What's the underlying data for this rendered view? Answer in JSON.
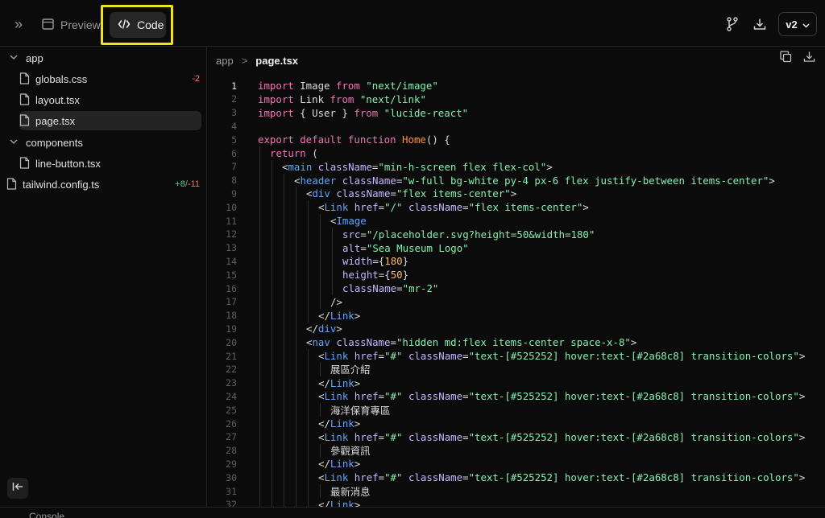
{
  "toolbar": {
    "preview_label": "Preview",
    "code_label": "Code",
    "version_label": "v2"
  },
  "sidebar": {
    "items": [
      {
        "label": "app",
        "type": "folder"
      },
      {
        "label": "globals.css",
        "type": "file",
        "del": "-2"
      },
      {
        "label": "layout.tsx",
        "type": "file"
      },
      {
        "label": "page.tsx",
        "type": "file",
        "selected": true
      },
      {
        "label": "components",
        "type": "folder"
      },
      {
        "label": "line-button.tsx",
        "type": "file"
      },
      {
        "label": "tailwind.config.ts",
        "type": "file",
        "add": "+8",
        "slash": "/",
        "del": "-11"
      }
    ]
  },
  "breadcrumb": {
    "folder": "app",
    "separator": ">",
    "file": "page.tsx"
  },
  "bottom": {
    "label": "Console"
  },
  "colors": {
    "keyword": "#f472b6",
    "string": "#86efac",
    "tag": "#60a5fa",
    "attribute": "#c4b5fd",
    "function": "#fb923c",
    "highlight": "#f2e21a"
  },
  "code_lines": [
    {
      "n": "1",
      "indent": 0,
      "parts": [
        [
          "kw",
          "import"
        ],
        [
          "",
          "Image "
        ],
        [
          "kw",
          "from"
        ],
        [
          "",
          ""
        ],
        [
          "str",
          "\"next/image\""
        ]
      ]
    },
    {
      "n": "2",
      "indent": 0,
      "parts": [
        [
          "kw",
          "import"
        ],
        [
          "",
          "Link "
        ],
        [
          "kw",
          "from"
        ],
        [
          "",
          ""
        ],
        [
          "str",
          "\"next/link\""
        ]
      ]
    },
    {
      "n": "3",
      "indent": 0,
      "parts": [
        [
          "kw",
          "import"
        ],
        [
          "",
          "{ User } "
        ],
        [
          "kw",
          "from"
        ],
        [
          "",
          ""
        ],
        [
          "str",
          "\"lucide-react\""
        ]
      ]
    },
    {
      "n": "4",
      "indent": 0,
      "parts": []
    },
    {
      "n": "5",
      "indent": 0,
      "parts": [
        [
          "kw",
          "export default function "
        ],
        [
          "fn",
          "Home"
        ],
        [
          "",
          "() {"
        ]
      ]
    },
    {
      "n": "6",
      "indent": 1,
      "parts": [
        [
          "kw",
          "return"
        ],
        [
          "",
          "("
        ]
      ]
    },
    {
      "n": "7",
      "indent": 2,
      "parts": [
        [
          "",
          "<"
        ],
        [
          "tag",
          "main"
        ],
        [
          "attr",
          " className"
        ],
        [
          "",
          "="
        ],
        [
          "str",
          "\"min-h-screen flex flex-col\""
        ],
        [
          "",
          ">"
        ]
      ]
    },
    {
      "n": "8",
      "indent": 3,
      "parts": [
        [
          "",
          "<"
        ],
        [
          "tag",
          "header"
        ],
        [
          "attr",
          " className"
        ],
        [
          "",
          "="
        ],
        [
          "str",
          "\"w-full bg-white py-4 px-6 flex justify-between items-center\""
        ],
        [
          "",
          ">"
        ]
      ]
    },
    {
      "n": "9",
      "indent": 4,
      "parts": [
        [
          "",
          "<"
        ],
        [
          "tag",
          "div"
        ],
        [
          "attr",
          " className"
        ],
        [
          "",
          "="
        ],
        [
          "str",
          "\"flex items-center\""
        ],
        [
          "",
          ">"
        ]
      ]
    },
    {
      "n": "10",
      "indent": 5,
      "parts": [
        [
          "",
          "<"
        ],
        [
          "tag",
          "Link"
        ],
        [
          "attr",
          " href"
        ],
        [
          "",
          "="
        ],
        [
          "str",
          "\"/\""
        ],
        [
          "attr",
          " className"
        ],
        [
          "",
          "="
        ],
        [
          "str",
          "\"flex items-center\""
        ],
        [
          "",
          ">"
        ]
      ]
    },
    {
      "n": "11",
      "indent": 6,
      "parts": [
        [
          "",
          "<"
        ],
        [
          "tag",
          "Image"
        ]
      ]
    },
    {
      "n": "12",
      "indent": 7,
      "parts": [
        [
          "attr",
          "src"
        ],
        [
          "",
          "="
        ],
        [
          "str",
          "\"/placeholder.svg?height=50&width=180\""
        ]
      ]
    },
    {
      "n": "13",
      "indent": 7,
      "parts": [
        [
          "attr",
          "alt"
        ],
        [
          "",
          "="
        ],
        [
          "str",
          "\"Sea Museum Logo\""
        ]
      ]
    },
    {
      "n": "14",
      "indent": 7,
      "parts": [
        [
          "attr",
          "width"
        ],
        [
          "",
          "={"
        ],
        [
          "num",
          "180"
        ],
        [
          "",
          "}"
        ]
      ]
    },
    {
      "n": "15",
      "indent": 7,
      "parts": [
        [
          "attr",
          "height"
        ],
        [
          "",
          "={"
        ],
        [
          "num",
          "50"
        ],
        [
          "",
          "}"
        ]
      ]
    },
    {
      "n": "16",
      "indent": 7,
      "parts": [
        [
          "attr",
          "className"
        ],
        [
          "",
          "="
        ],
        [
          "str",
          "\"mr-2\""
        ]
      ]
    },
    {
      "n": "17",
      "indent": 6,
      "parts": [
        [
          "",
          "/>"
        ]
      ]
    },
    {
      "n": "18",
      "indent": 5,
      "parts": [
        [
          "",
          "</"
        ],
        [
          "tag",
          "Link"
        ],
        [
          "",
          ">"
        ]
      ]
    },
    {
      "n": "19",
      "indent": 4,
      "parts": [
        [
          "",
          "</"
        ],
        [
          "tag",
          "div"
        ],
        [
          "",
          ">"
        ]
      ]
    },
    {
      "n": "20",
      "indent": 4,
      "parts": [
        [
          "",
          "<"
        ],
        [
          "tag",
          "nav"
        ],
        [
          "attr",
          " className"
        ],
        [
          "",
          "="
        ],
        [
          "str",
          "\"hidden md:flex items-center space-x-8\""
        ],
        [
          "",
          ">"
        ]
      ]
    },
    {
      "n": "21",
      "indent": 5,
      "parts": [
        [
          "",
          "<"
        ],
        [
          "tag",
          "Link"
        ],
        [
          "attr",
          " href"
        ],
        [
          "",
          "="
        ],
        [
          "str",
          "\"#\""
        ],
        [
          "attr",
          " className"
        ],
        [
          "",
          "="
        ],
        [
          "str",
          "\"text-[#525252] hover:text-[#2a68c8] transition-colors\""
        ],
        [
          "",
          ">"
        ]
      ]
    },
    {
      "n": "22",
      "indent": 6,
      "parts": [
        [
          "",
          "展區介紹"
        ]
      ]
    },
    {
      "n": "23",
      "indent": 5,
      "parts": [
        [
          "",
          "</"
        ],
        [
          "tag",
          "Link"
        ],
        [
          "",
          ">"
        ]
      ]
    },
    {
      "n": "24",
      "indent": 5,
      "parts": [
        [
          "",
          "<"
        ],
        [
          "tag",
          "Link"
        ],
        [
          "attr",
          " href"
        ],
        [
          "",
          "="
        ],
        [
          "str",
          "\"#\""
        ],
        [
          "attr",
          " className"
        ],
        [
          "",
          "="
        ],
        [
          "str",
          "\"text-[#525252] hover:text-[#2a68c8] transition-colors\""
        ],
        [
          "",
          ">"
        ]
      ]
    },
    {
      "n": "25",
      "indent": 6,
      "parts": [
        [
          "",
          "海洋保育專區"
        ]
      ]
    },
    {
      "n": "26",
      "indent": 5,
      "parts": [
        [
          "",
          "</"
        ],
        [
          "tag",
          "Link"
        ],
        [
          "",
          ">"
        ]
      ]
    },
    {
      "n": "27",
      "indent": 5,
      "parts": [
        [
          "",
          "<"
        ],
        [
          "tag",
          "Link"
        ],
        [
          "attr",
          " href"
        ],
        [
          "",
          "="
        ],
        [
          "str",
          "\"#\""
        ],
        [
          "attr",
          " className"
        ],
        [
          "",
          "="
        ],
        [
          "str",
          "\"text-[#525252] hover:text-[#2a68c8] transition-colors\""
        ],
        [
          "",
          ">"
        ]
      ]
    },
    {
      "n": "28",
      "indent": 6,
      "parts": [
        [
          "",
          "參觀資訊"
        ]
      ]
    },
    {
      "n": "29",
      "indent": 5,
      "parts": [
        [
          "",
          "</"
        ],
        [
          "tag",
          "Link"
        ],
        [
          "",
          ">"
        ]
      ]
    },
    {
      "n": "30",
      "indent": 5,
      "parts": [
        [
          "",
          "<"
        ],
        [
          "tag",
          "Link"
        ],
        [
          "attr",
          " href"
        ],
        [
          "",
          "="
        ],
        [
          "str",
          "\"#\""
        ],
        [
          "attr",
          " className"
        ],
        [
          "",
          "="
        ],
        [
          "str",
          "\"text-[#525252] hover:text-[#2a68c8] transition-colors\""
        ],
        [
          "",
          ">"
        ]
      ]
    },
    {
      "n": "31",
      "indent": 6,
      "parts": [
        [
          "",
          "最新消息"
        ]
      ]
    },
    {
      "n": "32",
      "indent": 5,
      "parts": [
        [
          "",
          "</"
        ],
        [
          "tag",
          "Link"
        ],
        [
          "",
          ">"
        ]
      ]
    }
  ]
}
